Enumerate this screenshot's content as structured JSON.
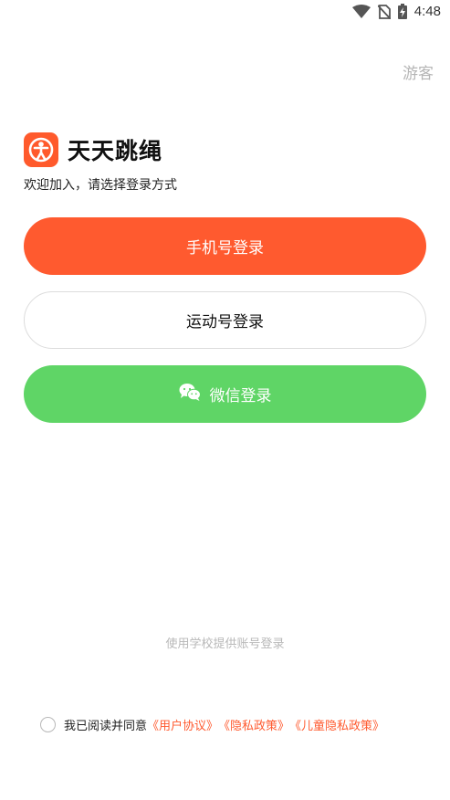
{
  "status_bar": {
    "time": "4:48",
    "icons": [
      "wifi-icon",
      "no-sim-icon",
      "battery-charging-icon"
    ]
  },
  "header": {
    "guest_label": "游客"
  },
  "brand": {
    "app_name": "天天跳绳",
    "logo_icon": "jumping-figure-icon",
    "subtitle": "欢迎加入，请选择登录方式"
  },
  "buttons": {
    "phone_login": "手机号登录",
    "sport_login": "运动号登录",
    "wechat_login": "微信登录"
  },
  "school_login": "使用学校提供账号登录",
  "agreement": {
    "prefix": "我已阅读并同意",
    "user_agreement": "《用户协议》",
    "privacy_policy": "《隐私政策》",
    "child_privacy_policy": "《儿童隐私政策》"
  },
  "colors": {
    "brand": "#ff5a2f",
    "wechat": "#5fd566",
    "muted": "#b8b8b8"
  }
}
